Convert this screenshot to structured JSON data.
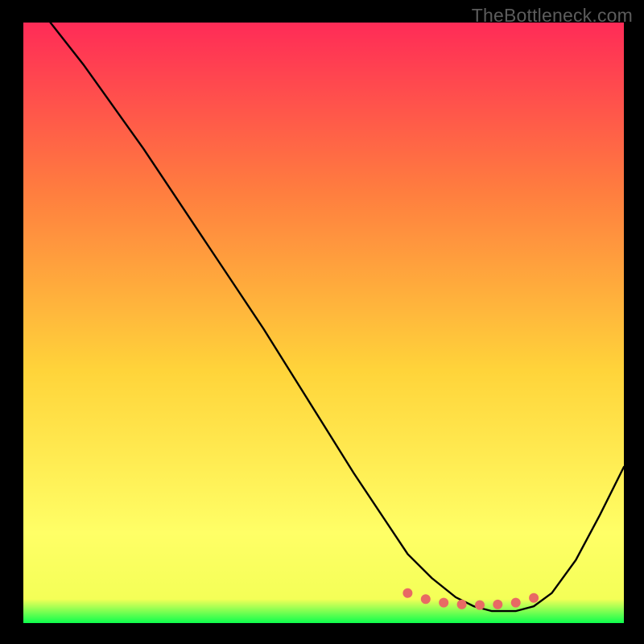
{
  "watermark": "TheBottleneck.com",
  "colors": {
    "background": "#000000",
    "gradient_top": "#ff2b57",
    "gradient_mid1": "#ff7d3f",
    "gradient_mid2": "#ffd43a",
    "gradient_low": "#ffff66",
    "gradient_bottom": "#0dff4d",
    "curve": "#000000",
    "marker": "#e86a64"
  },
  "chart_data": {
    "type": "line",
    "title": "",
    "xlabel": "",
    "ylabel": "",
    "xlim": [
      0,
      100
    ],
    "ylim": [
      0,
      100
    ],
    "series": [
      {
        "name": "curve",
        "x": [
          4.5,
          10,
          15,
          20,
          25,
          30,
          35,
          40,
          45,
          50,
          55,
          60,
          64,
          68,
          72,
          75,
          78,
          82,
          85,
          88,
          92,
          96,
          100
        ],
        "y": [
          100,
          93,
          86,
          79,
          71.5,
          64,
          56.5,
          49,
          41,
          33,
          25,
          17.5,
          11.5,
          7.5,
          4.3,
          2.8,
          2.0,
          2.0,
          2.8,
          5.0,
          10.5,
          18,
          26
        ]
      },
      {
        "name": "markers",
        "x": [
          64,
          67,
          70,
          73,
          76,
          79,
          82,
          85
        ],
        "y": [
          5.0,
          4.0,
          3.4,
          3.1,
          3.0,
          3.1,
          3.4,
          4.2
        ]
      }
    ]
  }
}
